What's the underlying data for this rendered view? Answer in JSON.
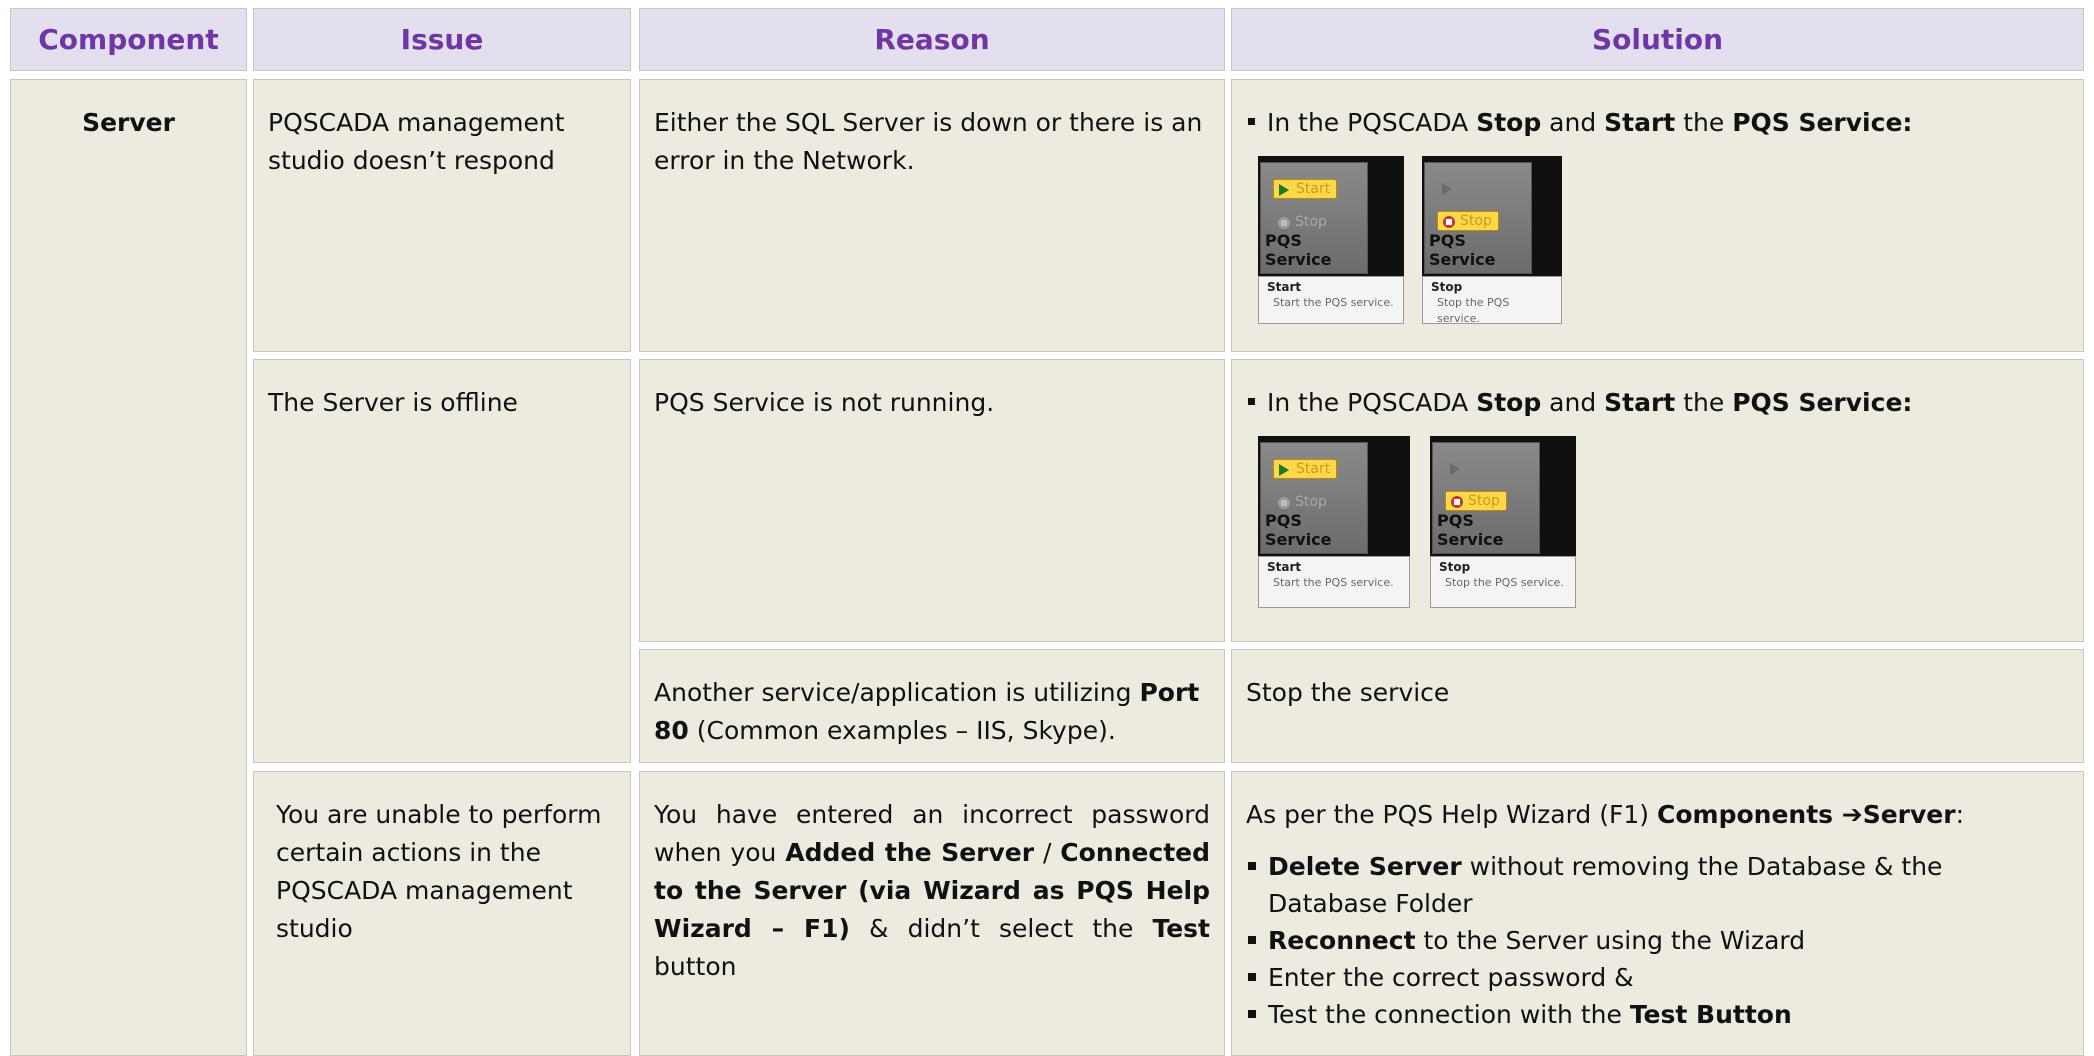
{
  "headers": {
    "component": "Component",
    "issue": "Issue",
    "reason": "Reason",
    "solution": "Solution"
  },
  "component": "Server",
  "row1": {
    "issue": "PQSCADA management studio doesn’t respond",
    "reason": "Either the SQL Server is down or there is an error in the Network.",
    "solution": {
      "prefix": "In the PQSCADA ",
      "stop": "Stop",
      "and": " and ",
      "start": "Start",
      "the": " the ",
      "service": "PQS Service:"
    }
  },
  "row2": {
    "issue": "The Server is offline",
    "reason": "PQS Service is not running.",
    "solution": {
      "prefix": "In the PQSCADA ",
      "stop": "Stop",
      "and": " and ",
      "start": "Start",
      "the": " the ",
      "service": "PQS Service:"
    }
  },
  "row3": {
    "reason_prefix": "Another service/application is utilizing ",
    "reason_port": "Port 80",
    "reason_suffix": " (Common examples – IIS, Skype).",
    "solution": "Stop the service"
  },
  "row4": {
    "issue": "You are unable to perform certain actions in the PQSCADA management studio",
    "reason": {
      "a": "You have entered an incorrect password when you ",
      "added": "Added the Server",
      "slash": " / ",
      "connected": "Connected to the Server (via Wizard as PQS Help Wizard – F1)",
      "c": " & didn’t select the ",
      "test": "Test",
      "d": " button"
    },
    "solution": {
      "intro_a": "As per the PQS Help Wizard (F1) ",
      "intro_comp": "Components",
      "intro_arrow": " ➔",
      "intro_server": "Server",
      "intro_colon": ":",
      "b1_bold": "Delete Server",
      "b1_rest": " without removing the Database & the Database Folder",
      "b2_bold": "Reconnect",
      "b2_rest": " to the Server using the Wizard",
      "b3": "Enter the correct password &",
      "b4_rest": "Test the connection with the ",
      "b4_bold": "Test Button"
    }
  },
  "service_widget": {
    "start_btn": "Start",
    "stop_btn": "Stop",
    "title": "PQS Service",
    "start_tip_title": "Start",
    "start_tip_desc": "Start the PQS service.",
    "stop_tip_title": "Stop",
    "stop_tip_desc": "Stop the PQS service."
  }
}
